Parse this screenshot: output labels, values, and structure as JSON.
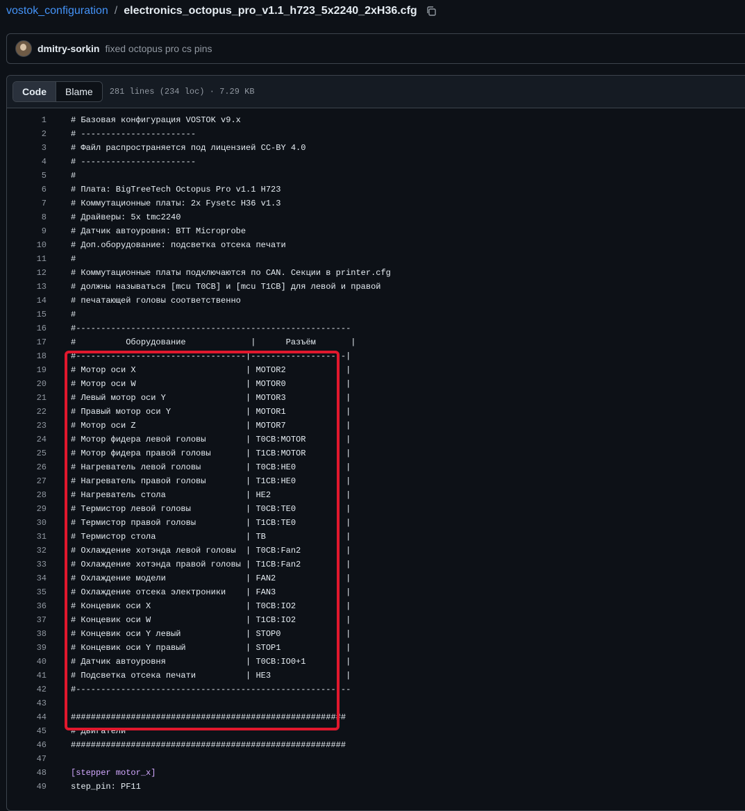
{
  "breadcrumb": {
    "repo": "vostok_configuration",
    "separator": "/",
    "file": "electronics_octopus_pro_v1.1_h723_5x2240_2xH36.cfg"
  },
  "commit": {
    "author": "dmitry-sorkin",
    "message": "fixed octopus pro cs pins"
  },
  "file_header": {
    "tabs": [
      "Code",
      "Blame"
    ],
    "active_tab": "Code",
    "info": "281 lines (234 loc) · 7.29 KB"
  },
  "colors": {
    "background": "#0d1117",
    "link": "#4493f8",
    "highlight_border": "#e0182d",
    "section_header": "#d2a8ff"
  },
  "icons": {
    "copy": "copy-icon"
  },
  "code_lines": [
    {
      "n": "1",
      "text": "# Базовая конфигурация VOSTOK v9.x"
    },
    {
      "n": "2",
      "text": "# -----------------------"
    },
    {
      "n": "3",
      "text": "# Файл распространяется под лицензией CC-BY 4.0"
    },
    {
      "n": "4",
      "text": "# -----------------------"
    },
    {
      "n": "5",
      "text": "#"
    },
    {
      "n": "6",
      "text": "# Плата: BigTreeTech Octopus Pro v1.1 H723"
    },
    {
      "n": "7",
      "text": "# Коммутационные платы: 2x Fysetc H36 v1.3"
    },
    {
      "n": "8",
      "text": "# Драйверы: 5x tmc2240"
    },
    {
      "n": "9",
      "text": "# Датчик автоуровня: BTT Microprobe"
    },
    {
      "n": "10",
      "text": "# Доп.оборудование: подсветка отсека печати"
    },
    {
      "n": "11",
      "text": "#"
    },
    {
      "n": "12",
      "text": "# Коммутационные платы подключаются по CAN. Секции в printer.cfg"
    },
    {
      "n": "13",
      "text": "# должны называться [mcu T0CB] и [mcu T1CB] для левой и правой"
    },
    {
      "n": "14",
      "text": "# печатающей головы соответственно"
    },
    {
      "n": "15",
      "text": "#"
    },
    {
      "n": "16",
      "text": "#-------------------------------------------------------"
    },
    {
      "n": "17",
      "text": "#          Оборудование             |      Разъём       |"
    },
    {
      "n": "18",
      "text": "#----------------------------------|-------------------|"
    },
    {
      "n": "19",
      "text": "# Мотор оси X                      | MOTOR2            |"
    },
    {
      "n": "20",
      "text": "# Мотор оси W                      | MOTOR0            |"
    },
    {
      "n": "21",
      "text": "# Левый мотор оси Y                | MOTOR3            |"
    },
    {
      "n": "22",
      "text": "# Правый мотор оси Y               | MOTOR1            |"
    },
    {
      "n": "23",
      "text": "# Мотор оси Z                      | MOTOR7            |"
    },
    {
      "n": "24",
      "text": "# Мотор фидера левой головы        | T0CB:MOTOR        |"
    },
    {
      "n": "25",
      "text": "# Мотор фидера правой головы       | T1CB:MOTOR        |"
    },
    {
      "n": "26",
      "text": "# Нагреватель левой головы         | T0CB:HE0          |"
    },
    {
      "n": "27",
      "text": "# Нагреватель правой головы        | T1CB:HE0          |"
    },
    {
      "n": "28",
      "text": "# Нагреватель стола                | HE2               |"
    },
    {
      "n": "29",
      "text": "# Термистор левой головы           | T0CB:TE0          |"
    },
    {
      "n": "30",
      "text": "# Термистор правой головы          | T1CB:TE0          |"
    },
    {
      "n": "31",
      "text": "# Термистор стола                  | TB                |"
    },
    {
      "n": "32",
      "text": "# Охлаждение хотэнда левой головы  | T0CB:Fan2         |"
    },
    {
      "n": "33",
      "text": "# Охлаждение хотэнда правой головы | T1CB:Fan2         |"
    },
    {
      "n": "34",
      "text": "# Охлаждение модели                | FAN2              |"
    },
    {
      "n": "35",
      "text": "# Охлаждение отсека электроники    | FAN3              |"
    },
    {
      "n": "36",
      "text": "# Концевик оси X                   | T0CB:IO2          |"
    },
    {
      "n": "37",
      "text": "# Концевик оси W                   | T1CB:IO2          |"
    },
    {
      "n": "38",
      "text": "# Концевик оси Y левый             | STOP0             |"
    },
    {
      "n": "39",
      "text": "# Концевик оси Y правый            | STOP1             |"
    },
    {
      "n": "40",
      "text": "# Датчик автоуровня                | T0CB:IO0+1        |"
    },
    {
      "n": "41",
      "text": "# Подсветка отсека печати          | HE3               |"
    },
    {
      "n": "42",
      "text": "#-------------------------------------------------------"
    },
    {
      "n": "43",
      "text": ""
    },
    {
      "n": "44",
      "text": "#######################################################"
    },
    {
      "n": "45",
      "text": "# Двигатели"
    },
    {
      "n": "46",
      "text": "#######################################################"
    },
    {
      "n": "47",
      "text": ""
    },
    {
      "n": "48",
      "text": "[stepper motor_x]",
      "kind": "sec"
    },
    {
      "n": "49",
      "text": "step_pin: PF11",
      "kind": "key"
    }
  ]
}
